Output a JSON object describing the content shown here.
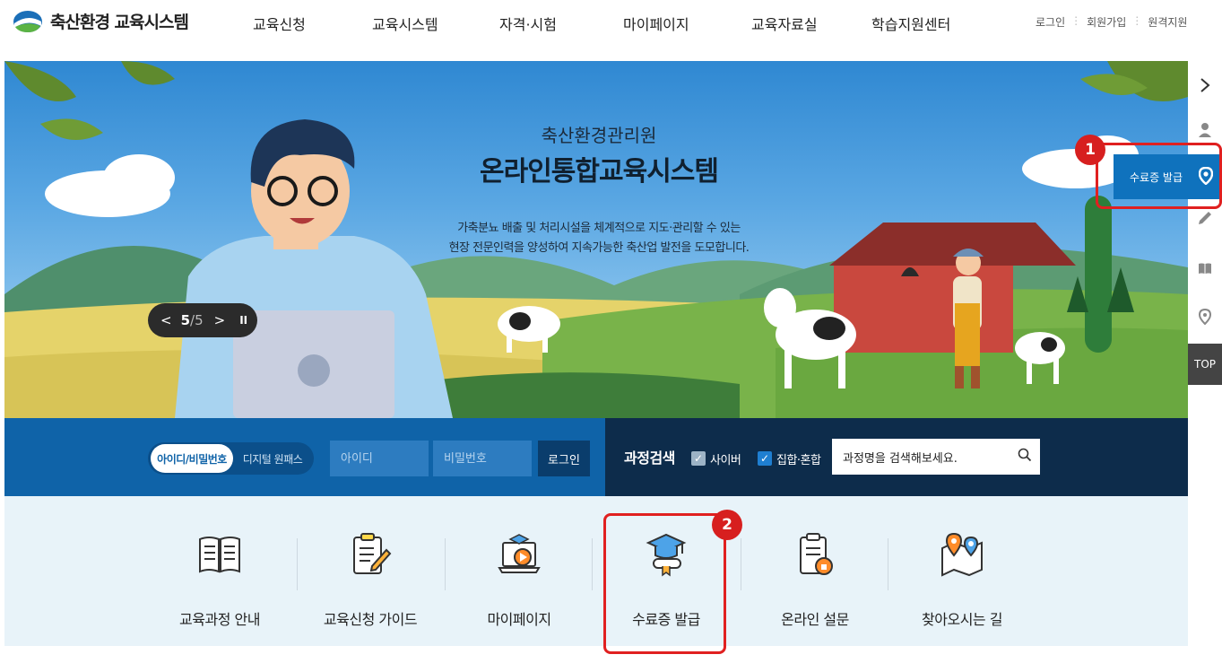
{
  "header": {
    "logo_text": "축산환경 교육시스템",
    "nav": [
      "교육신청",
      "교육시스템",
      "자격·시험",
      "마이페이지",
      "교육자료실",
      "학습지원센터"
    ],
    "util": [
      "로그인",
      "회원가입",
      "원격지원"
    ]
  },
  "hero": {
    "subtitle": "축산환경관리원",
    "title": "온라인통합교육시스템",
    "desc_line1": "가축분뇨 배출 및 처리시설을 체계적으로 지도·관리할 수 있는",
    "desc_line2": "현장 전문인력을 양성하여 지속가능한 축산업 발전을 도모합니다.",
    "pager": {
      "prev": "<",
      "current": "5",
      "total": "/5",
      "next": ">",
      "pause": "II"
    }
  },
  "login": {
    "tab_active": "아이디/비밀번호",
    "tab_inactive": "디지털 원패스",
    "id_placeholder": "아이디",
    "pw_placeholder": "비밀번호",
    "button": "로그인"
  },
  "search": {
    "label": "과정검색",
    "options": [
      {
        "label": "사이버",
        "checked": true
      },
      {
        "label": "집합·혼합",
        "checked": true
      }
    ],
    "value": "과정명을 검색해보세요."
  },
  "quick_menu": [
    {
      "label": "교육과정 안내",
      "icon": "book-icon"
    },
    {
      "label": "교육신청 가이드",
      "icon": "clipboard-pencil-icon"
    },
    {
      "label": "마이페이지",
      "icon": "laptop-play-icon"
    },
    {
      "label": "수료증 발급",
      "icon": "graduation-cap-icon"
    },
    {
      "label": "온라인 설문",
      "icon": "clipboard-lock-icon"
    },
    {
      "label": "찾아오시는 길",
      "icon": "map-pin-icon"
    }
  ],
  "right_bar": {
    "items": [
      "chevron-right-icon",
      "user-icon",
      "location-pin-icon",
      "pencil-icon",
      "book-open-icon",
      "map-pin-icon"
    ],
    "cert_label": "수료증 발급",
    "top_label": "TOP"
  },
  "annotations": {
    "badge1": "1",
    "badge2": "2"
  },
  "colors": {
    "primary": "#0f63a8",
    "dark_navy": "#0d2c4b",
    "highlight": "#e02020",
    "quick_bg": "#e8f3f9"
  }
}
